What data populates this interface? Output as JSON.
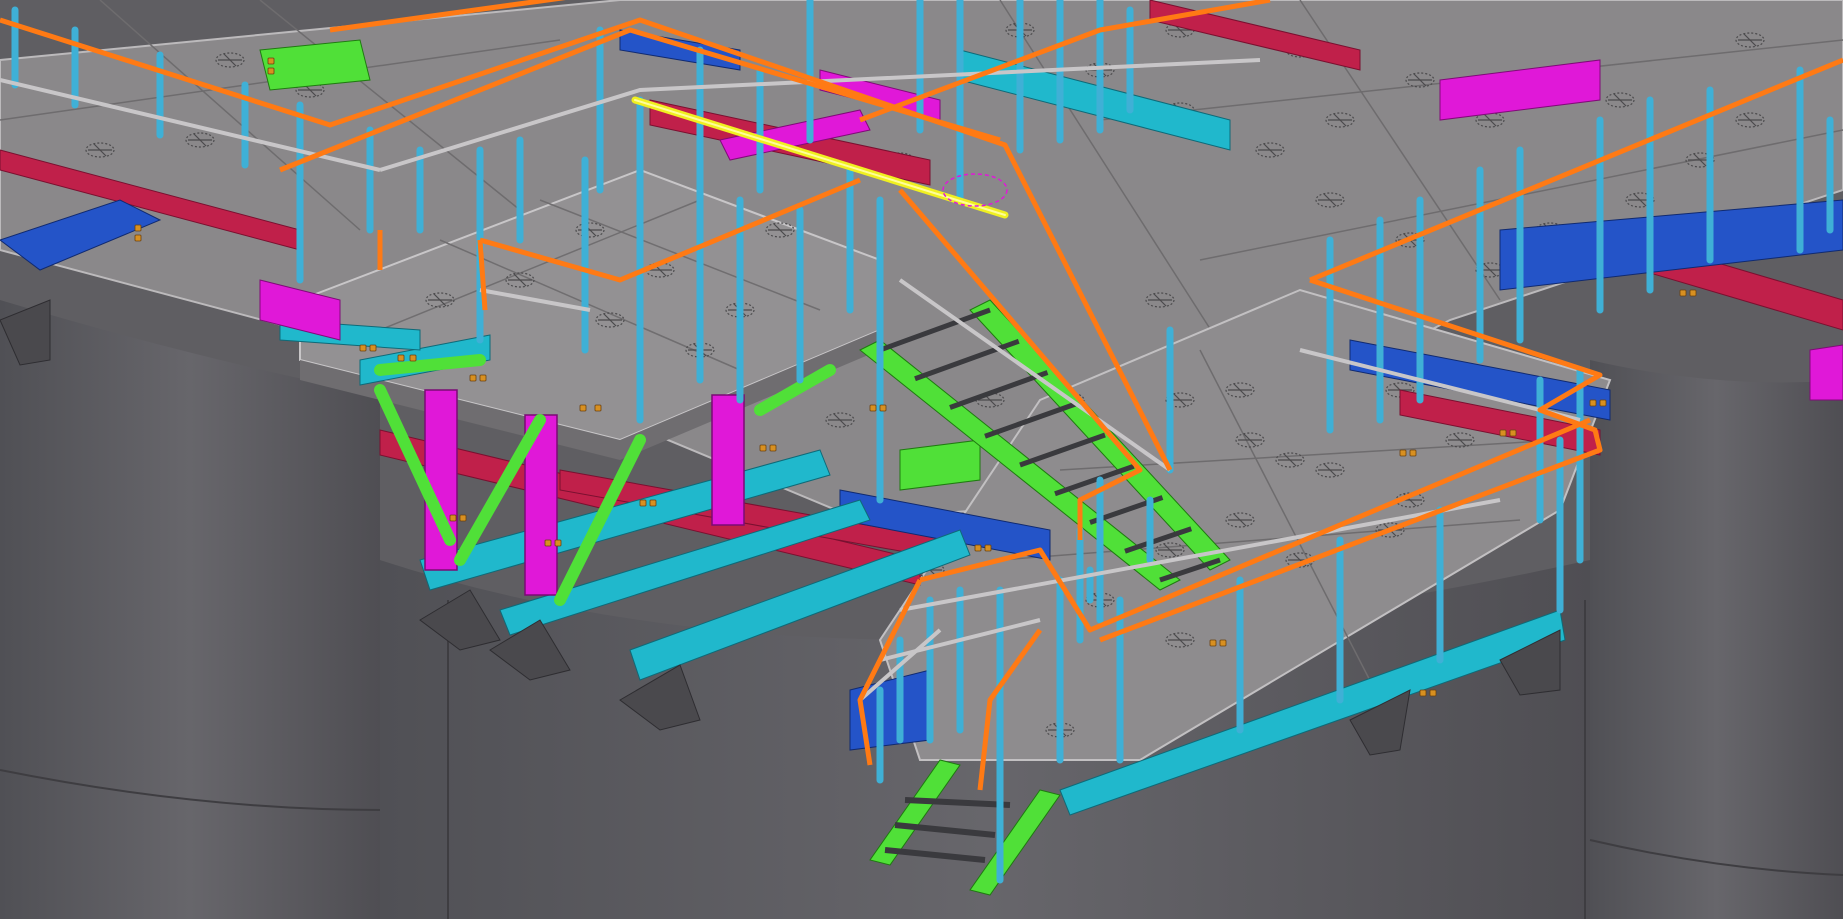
{
  "scene": {
    "kind": "3D structural steel model viewport",
    "selected_member": "handrail-top-rail",
    "colors": {
      "background": "#5f5e62",
      "tank_wall": "#5c5b5f",
      "tank_wall_dark": "#4d4c50",
      "grating": "#8c8a8c",
      "grating_edge": "#b8b6b8",
      "handrail": "#ff7a14",
      "post": "#3fb0d6",
      "beam_cyan": "#20b8cc",
      "beam_red": "#c0204a",
      "beam_blue": "#2050c8",
      "column_magenta": "#e018d8",
      "brace_green": "#50e038",
      "selection": "#f0f020",
      "bolt": "#d89020"
    },
    "icons": [
      "grating-hatch-icon",
      "bolt-icon",
      "selection-cursor-icon"
    ]
  }
}
